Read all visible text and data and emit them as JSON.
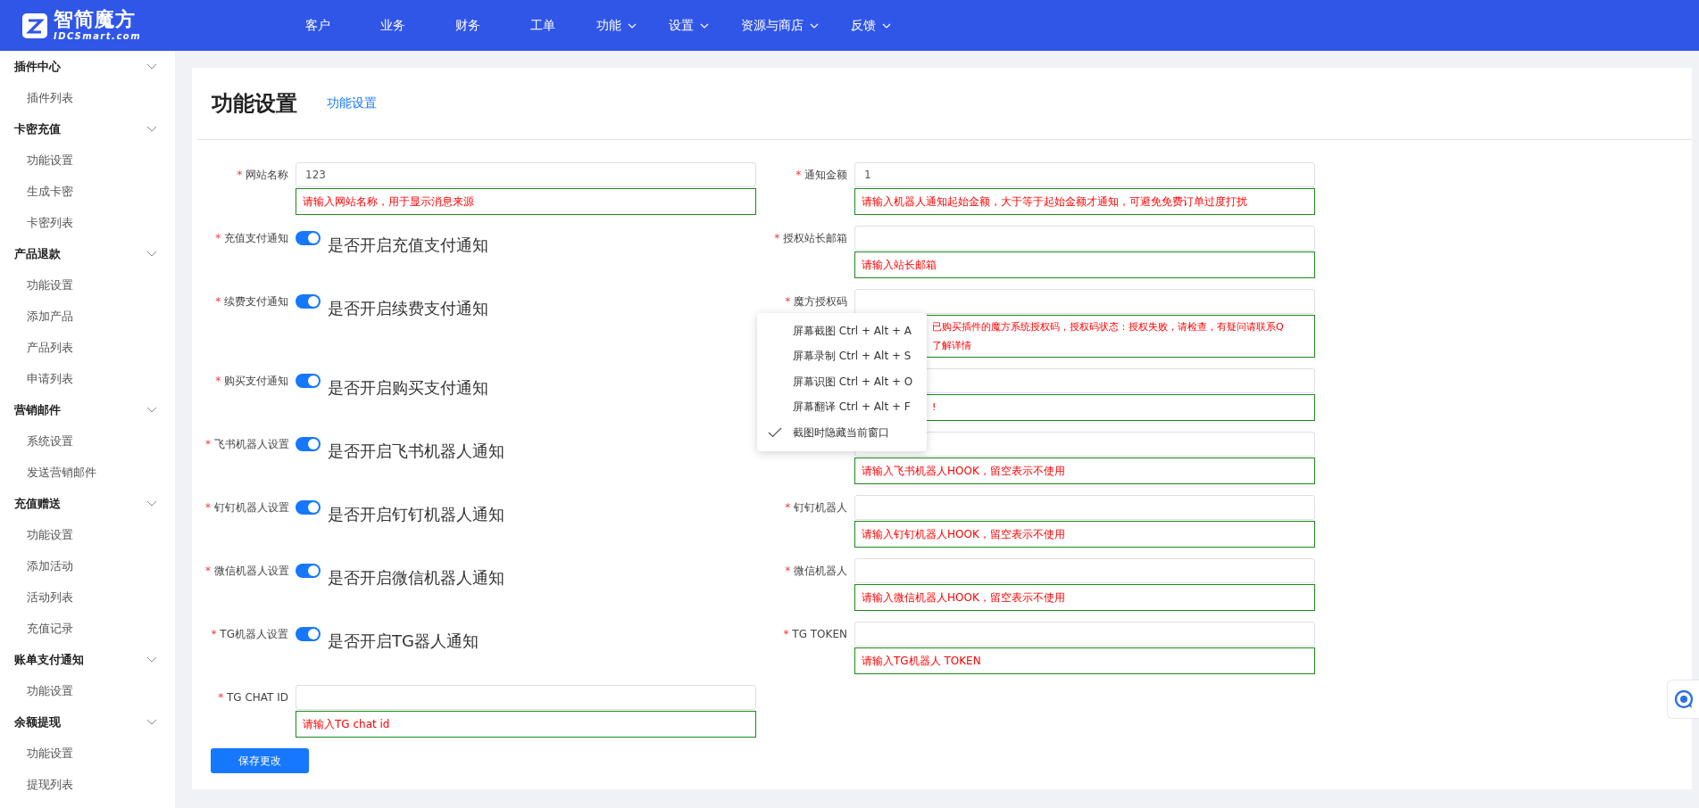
{
  "logo": {
    "name": "智简魔方",
    "sub": "IDCSmart.com"
  },
  "nav": [
    {
      "label": "客户",
      "dropdown": false
    },
    {
      "label": "业务",
      "dropdown": false
    },
    {
      "label": "财务",
      "dropdown": false
    },
    {
      "label": "工单",
      "dropdown": false
    },
    {
      "label": "功能",
      "dropdown": true
    },
    {
      "label": "设置",
      "dropdown": true
    },
    {
      "label": "资源与商店",
      "dropdown": true
    },
    {
      "label": "反馈",
      "dropdown": true
    }
  ],
  "sidebar": [
    {
      "label": "插件中心",
      "expanded": true,
      "children": [
        {
          "label": "插件列表"
        }
      ]
    },
    {
      "label": "卡密充值",
      "expanded": true,
      "children": [
        {
          "label": "功能设置"
        },
        {
          "label": "生成卡密"
        },
        {
          "label": "卡密列表"
        }
      ]
    },
    {
      "label": "产品退款",
      "expanded": true,
      "children": [
        {
          "label": "功能设置"
        },
        {
          "label": "添加产品"
        },
        {
          "label": "产品列表"
        },
        {
          "label": "申请列表"
        }
      ]
    },
    {
      "label": "营销邮件",
      "expanded": true,
      "children": [
        {
          "label": "系统设置"
        },
        {
          "label": "发送营销邮件"
        }
      ]
    },
    {
      "label": "充值赠送",
      "expanded": true,
      "children": [
        {
          "label": "功能设置"
        },
        {
          "label": "添加活动"
        },
        {
          "label": "活动列表"
        },
        {
          "label": "充值记录"
        }
      ]
    },
    {
      "label": "账单支付通知",
      "expanded": true,
      "children": [
        {
          "label": "功能设置"
        }
      ]
    },
    {
      "label": "余额提现",
      "expanded": true,
      "children": [
        {
          "label": "功能设置"
        },
        {
          "label": "提现列表"
        }
      ]
    }
  ],
  "page": {
    "title": "功能设置",
    "tab": "功能设置"
  },
  "form": {
    "rows": [
      {
        "left": {
          "kind": "field",
          "label": "网站名称",
          "value": "123",
          "hint": "请输入网站名称，用于显示消息来源"
        },
        "right": {
          "kind": "field",
          "label": "通知金额",
          "value": "1",
          "hint": "请输入机器人通知起始金额，大于等于起始金额才通知，可避免免费订单过度打扰"
        }
      },
      {
        "left": {
          "kind": "toggle",
          "label": "充值支付通知",
          "on": true,
          "text": "是否开启充值支付通知"
        },
        "right": {
          "kind": "field",
          "label": "授权站长邮箱",
          "hint": "请输入站长邮箱"
        }
      },
      {
        "left": {
          "kind": "toggle",
          "label": "续费支付通知",
          "on": true,
          "text": "是否开启续费支付通知"
        },
        "right": {
          "kind": "field",
          "label": "魔方授权码",
          "hint_lines": [
            "已购买插件的魔方系统授权码，授权码状态：授权失败，请检查，有疑问请联系Q",
            "了解详情"
          ],
          "under_menu": true
        }
      },
      {
        "left": {
          "kind": "toggle",
          "label": "购买支付通知",
          "on": true,
          "text": "是否开启购买支付通知"
        },
        "right": {
          "kind": "field",
          "hint": "!",
          "under_menu": true
        }
      },
      {
        "left": {
          "kind": "toggle",
          "label": "飞书机器人设置",
          "on": true,
          "text": "是否开启飞书机器人通知"
        },
        "right": {
          "kind": "field",
          "hint": "请输入飞书机器人HOOK，留空表示不使用"
        }
      },
      {
        "left": {
          "kind": "toggle",
          "label": "钉钉机器人设置",
          "on": true,
          "text": "是否开启钉钉机器人通知"
        },
        "right": {
          "kind": "field",
          "label": "钉钉机器人",
          "hint": "请输入钉钉机器人HOOK，留空表示不使用"
        }
      },
      {
        "left": {
          "kind": "toggle",
          "label": "微信机器人设置",
          "on": true,
          "text": "是否开启微信机器人通知"
        },
        "right": {
          "kind": "field",
          "label": "微信机器人",
          "hint": "请输入微信机器人HOOK，留空表示不使用"
        }
      },
      {
        "left": {
          "kind": "toggle",
          "label": "TG机器人设置",
          "on": true,
          "text": "是否开启TG器人通知"
        },
        "right": {
          "kind": "field",
          "label": "TG TOKEN",
          "hint": "请输入TG机器人 TOKEN"
        }
      },
      {
        "left": {
          "kind": "field",
          "label": "TG CHAT ID",
          "hint": "请输入TG chat id"
        }
      }
    ],
    "save": "保存更改",
    "required_mark": "*"
  },
  "context_menu": [
    {
      "label": "屏幕截图 Ctrl + Alt + A",
      "checked": false
    },
    {
      "label": "屏幕录制 Ctrl + Alt + S",
      "checked": false
    },
    {
      "label": "屏幕识图 Ctrl + Alt + O",
      "checked": false
    },
    {
      "label": "屏幕翻译 Ctrl + Alt + F",
      "checked": false
    },
    {
      "label": "截图时隐藏当前窗口",
      "checked": true
    }
  ]
}
